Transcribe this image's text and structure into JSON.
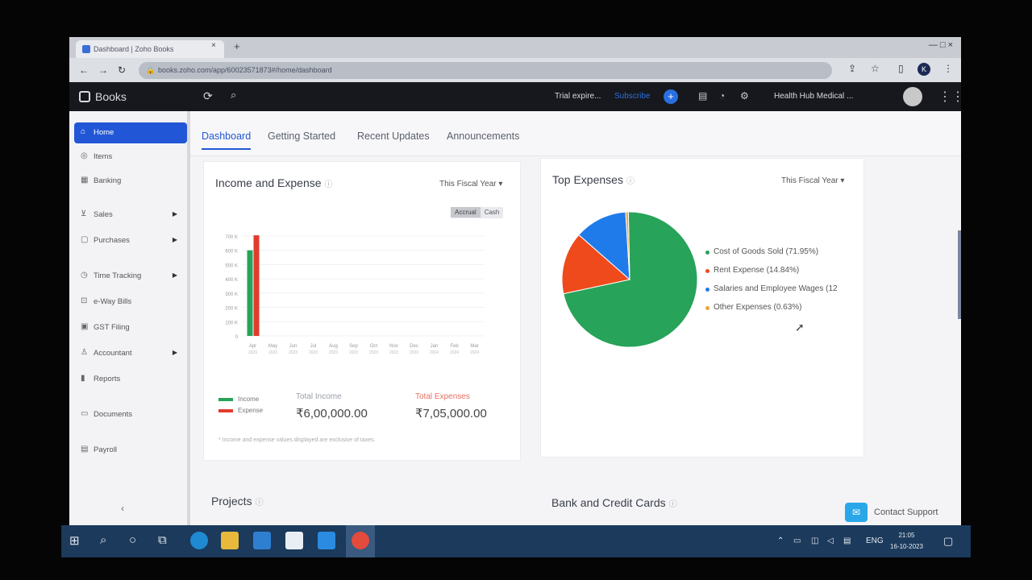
{
  "browser": {
    "tab_title": "Dashboard | Zoho Books",
    "tab_close": "×",
    "new_tab": "+",
    "url": "books.zoho.com/app/60023571873#/home/dashboard",
    "window_controls": "—  □  ×"
  },
  "app": {
    "name": "Books",
    "trial_text": "Trial expire...",
    "subscribe_label": "Subscribe",
    "org_name": "Health Hub Medical ..."
  },
  "sidebar": {
    "items": [
      {
        "label": "Home",
        "icon": "home-icon",
        "active": true
      },
      {
        "label": "Items",
        "icon": "items-icon"
      },
      {
        "label": "Banking",
        "icon": "bank-icon"
      },
      {
        "label": "Sales",
        "icon": "cart-icon",
        "has_children": true
      },
      {
        "label": "Purchases",
        "icon": "bag-icon",
        "has_children": true
      },
      {
        "label": "Time Tracking",
        "icon": "clock-icon",
        "has_children": true
      },
      {
        "label": "e-Way Bills",
        "icon": "truck-icon"
      },
      {
        "label": "GST Filing",
        "icon": "gst-icon"
      },
      {
        "label": "Accountant",
        "icon": "person-icon",
        "has_children": true
      },
      {
        "label": "Reports",
        "icon": "reports-icon"
      },
      {
        "label": "Documents",
        "icon": "folder-icon"
      },
      {
        "label": "Payroll",
        "icon": "payroll-icon"
      }
    ],
    "collapse_label": "‹"
  },
  "tabs": [
    "Dashboard",
    "Getting Started",
    "Recent Updates",
    "Announcements"
  ],
  "income_expense": {
    "title": "Income and Expense",
    "period": "This Fiscal Year",
    "basis_options": [
      "Accrual",
      "Cash"
    ],
    "legend_income": "Income",
    "legend_expense": "Expense",
    "total_income_label": "Total Income",
    "total_income_value": "₹6,00,000.00",
    "total_expense_label": "Total Expenses",
    "total_expense_value": "₹7,05,000.00",
    "footnote": "* Income and expense values displayed are exclusive of taxes.",
    "colors": {
      "income": "#27a35a",
      "expense": "#e23b2e"
    }
  },
  "chart_data": [
    {
      "type": "bar",
      "title": "",
      "categories": [
        "Apr 2023",
        "May 2023",
        "Jun 2023",
        "Jul 2023",
        "Aug 2023",
        "Sep 2023",
        "Oct 2023",
        "Nov 2023",
        "Dec 2023",
        "Jan 2024",
        "Feb 2024",
        "Mar 2024"
      ],
      "y_ticks": [
        "0",
        "100 K",
        "200 K",
        "300 K",
        "400 K",
        "500 K",
        "600 K",
        "700 K"
      ],
      "ylim": [
        0,
        700
      ],
      "series": [
        {
          "name": "Income",
          "values": [
            600,
            0,
            0,
            0,
            0,
            0,
            0,
            0,
            0,
            0,
            0,
            0
          ]
        },
        {
          "name": "Expense",
          "values": [
            705,
            0,
            0,
            0,
            0,
            0,
            0,
            0,
            0,
            0,
            0,
            0
          ]
        }
      ]
    },
    {
      "type": "pie",
      "title": "",
      "labels": [
        "Cost of Goods Sold (71.95%)",
        "Rent Expense (14.84%)",
        "Salaries and Employee Wages (12",
        "Other Expenses (0.63%)"
      ],
      "values": [
        71.95,
        14.84,
        12.58,
        0.63
      ],
      "colors": [
        "#27a35a",
        "#ef4a1c",
        "#1f7bea",
        "#f2a23a"
      ]
    }
  ],
  "top_expenses": {
    "title": "Top Expenses",
    "period": "This Fiscal Year"
  },
  "sections": {
    "projects": "Projects",
    "bank_cards": "Bank and Credit Cards"
  },
  "support": {
    "label": "Contact Support"
  },
  "taskbar": {
    "tray_lang": "ENG",
    "time": "21:05",
    "date": "16-10-2023"
  }
}
